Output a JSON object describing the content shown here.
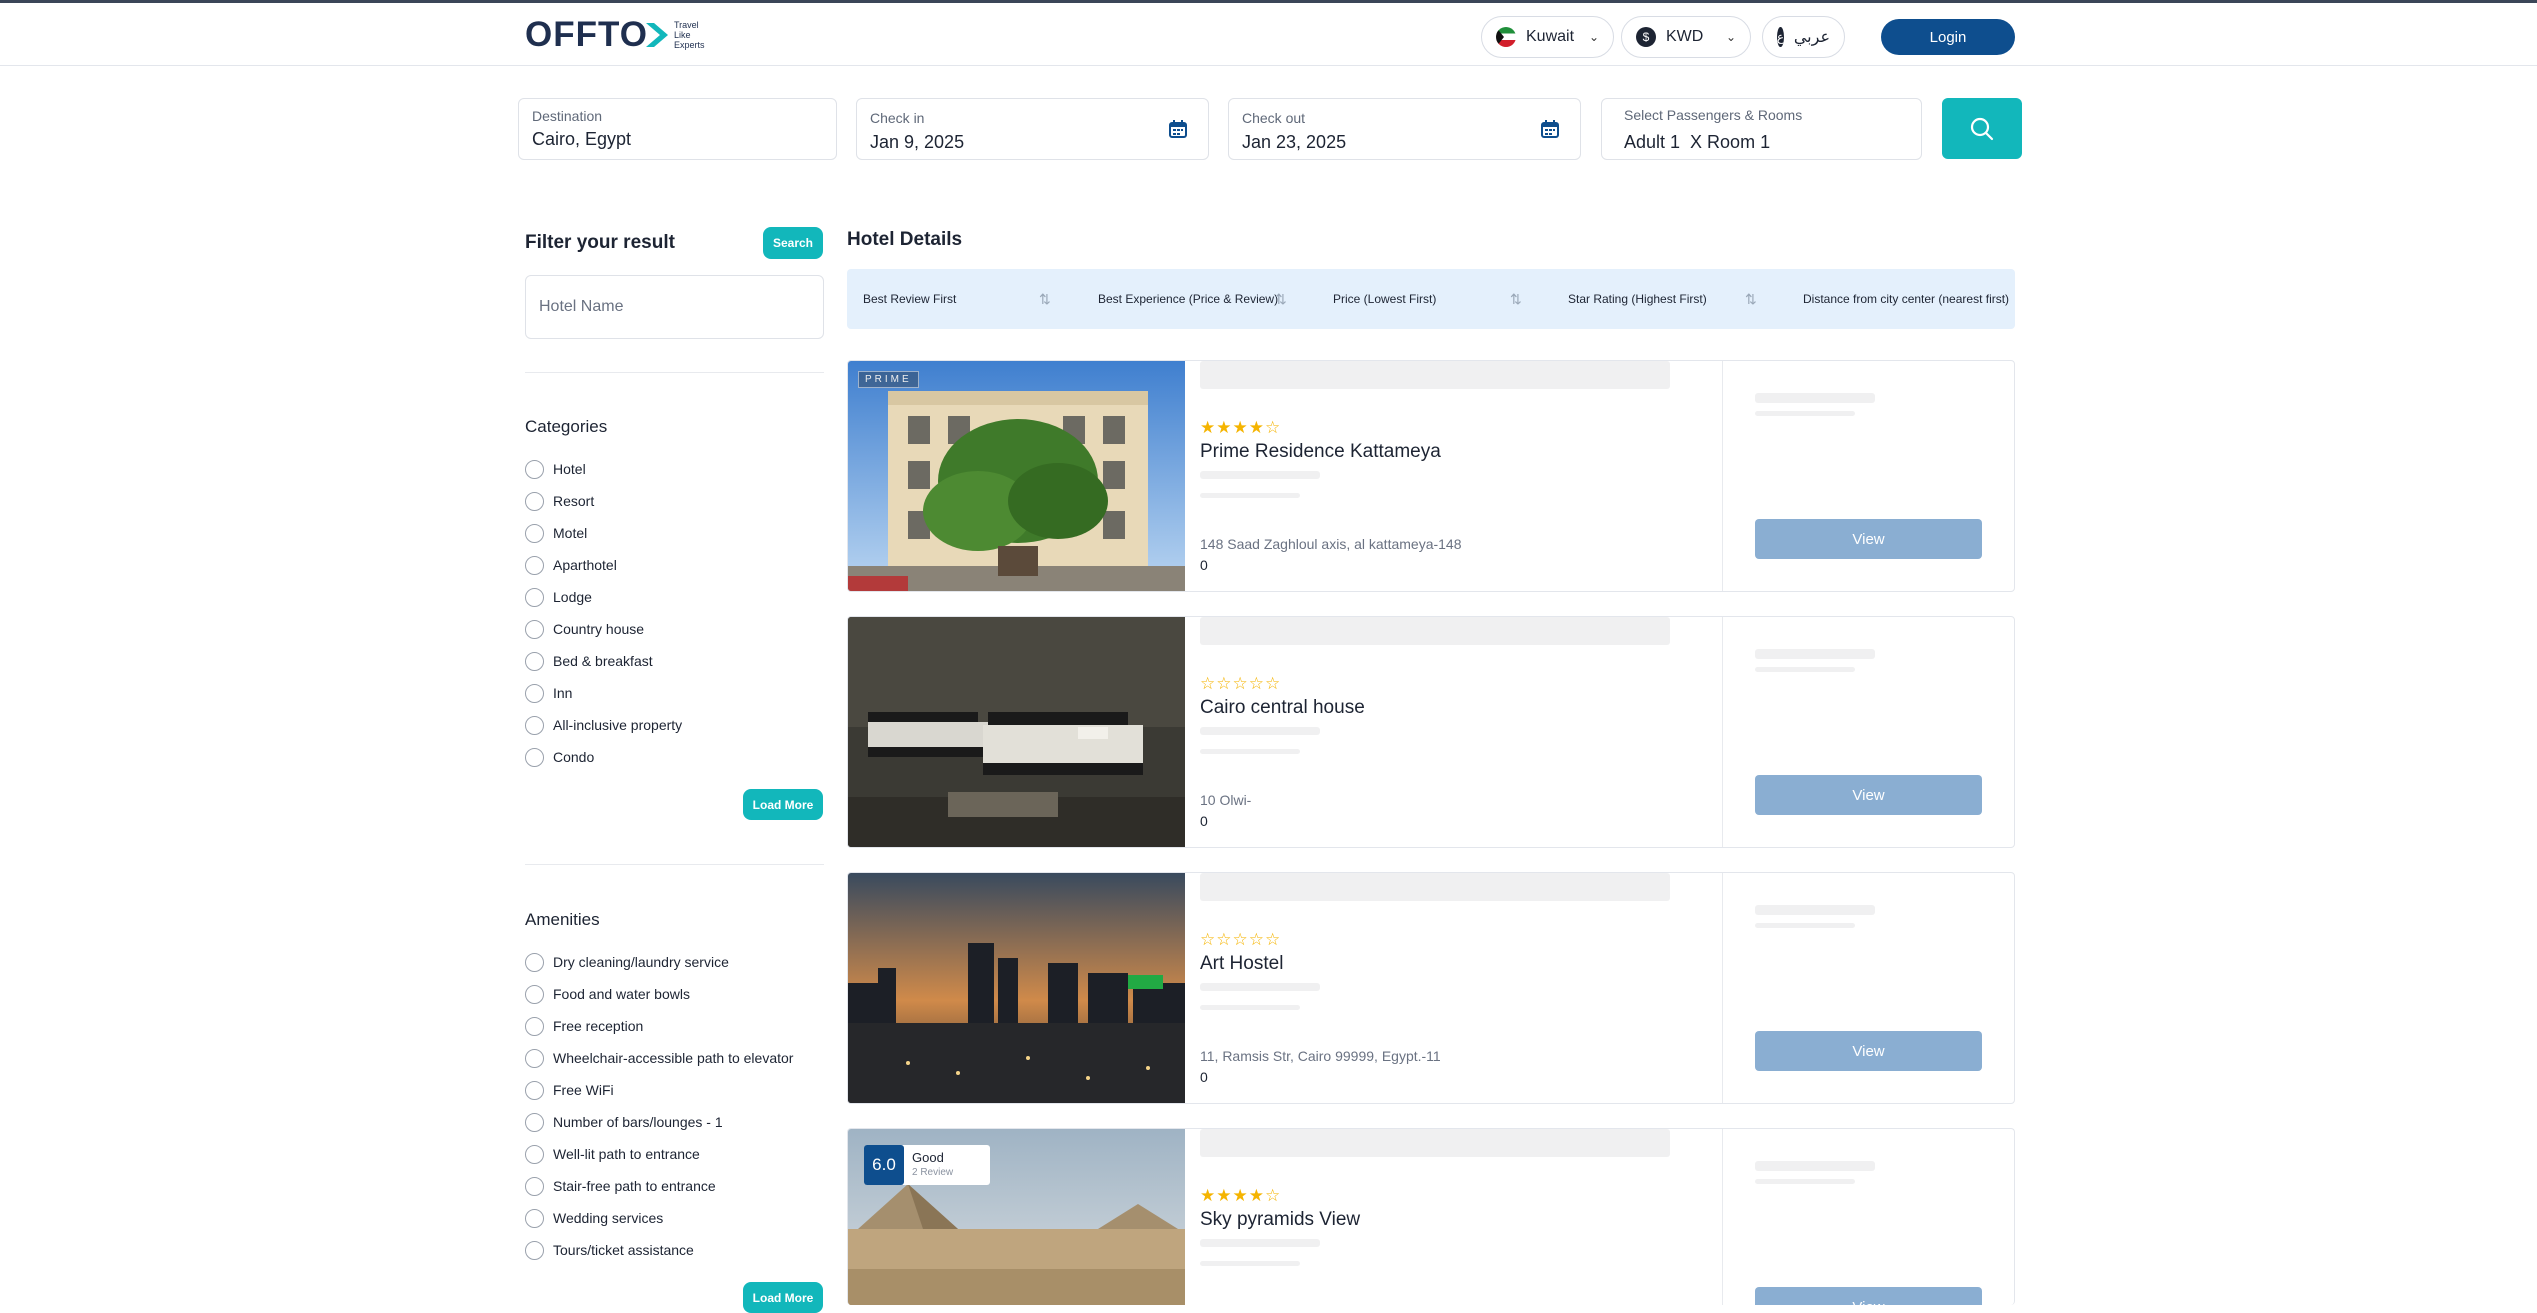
{
  "header": {
    "logo_text": "OFFTO",
    "logo_tagline": [
      "Travel",
      "Like",
      "Experts"
    ],
    "country": "Kuwait",
    "currency": "KWD",
    "currency_symbol": "$",
    "language": "عربي",
    "language_symbol": "ع",
    "login_label": "Login"
  },
  "search": {
    "destination_label": "Destination",
    "destination_value": "Cairo, Egypt",
    "checkin_label": "Check in",
    "checkin_value": "Jan 9, 2025",
    "checkout_label": "Check out",
    "checkout_value": "Jan 23, 2025",
    "passengers_label": "Select Passengers & Rooms",
    "passengers_value": "Adult 1  X Room 1"
  },
  "filters": {
    "title": "Filter your result",
    "search_label": "Search",
    "hotel_name_placeholder": "Hotel Name",
    "categories_title": "Categories",
    "categories": [
      "Hotel",
      "Resort",
      "Motel",
      "Aparthotel",
      "Lodge",
      "Country house",
      "Bed & breakfast",
      "Inn",
      "All-inclusive property",
      "Condo"
    ],
    "amenities_title": "Amenities",
    "amenities": [
      "Dry cleaning/laundry service",
      "Food and water bowls",
      "Free reception",
      "Wheelchair-accessible path to elevator",
      "Free WiFi",
      "Number of bars/lounges - 1",
      "Well-lit path to entrance",
      "Stair-free path to entrance",
      "Wedding services",
      "Tours/ticket assistance"
    ],
    "load_more_label": "Load More"
  },
  "results": {
    "title": "Hotel Details",
    "sort_options": [
      "Best Review First",
      "Best Experience (Price & Review)",
      "Price (Lowest First)",
      "Star Rating (Highest First)",
      "Distance from city center (nearest first)"
    ],
    "view_label": "View",
    "hotels": [
      {
        "name": "Prime Residence Kattameya",
        "address": "148 Saad Zaghloul axis, al kattameya-148",
        "value": "0",
        "stars": 4,
        "photo_tag": "PRIME"
      },
      {
        "name": "Cairo central house",
        "address": "10 Olwi-",
        "value": "0",
        "stars": 0
      },
      {
        "name": "Art Hostel",
        "address": "11, Ramsis Str, Cairo 99999, Egypt.-11",
        "value": "0",
        "stars": 0
      },
      {
        "name": "Sky pyramids View",
        "address": "",
        "value": "",
        "stars": 4,
        "score": "6.0",
        "score_label": "Good",
        "score_reviews": "2 Review"
      }
    ]
  },
  "colors": {
    "brand_dark": "#0e4e8e",
    "teal": "#12b7bb",
    "view_button": "#8aaed2",
    "star": "#f5b400",
    "sortbar_bg": "#e4f0fc"
  }
}
